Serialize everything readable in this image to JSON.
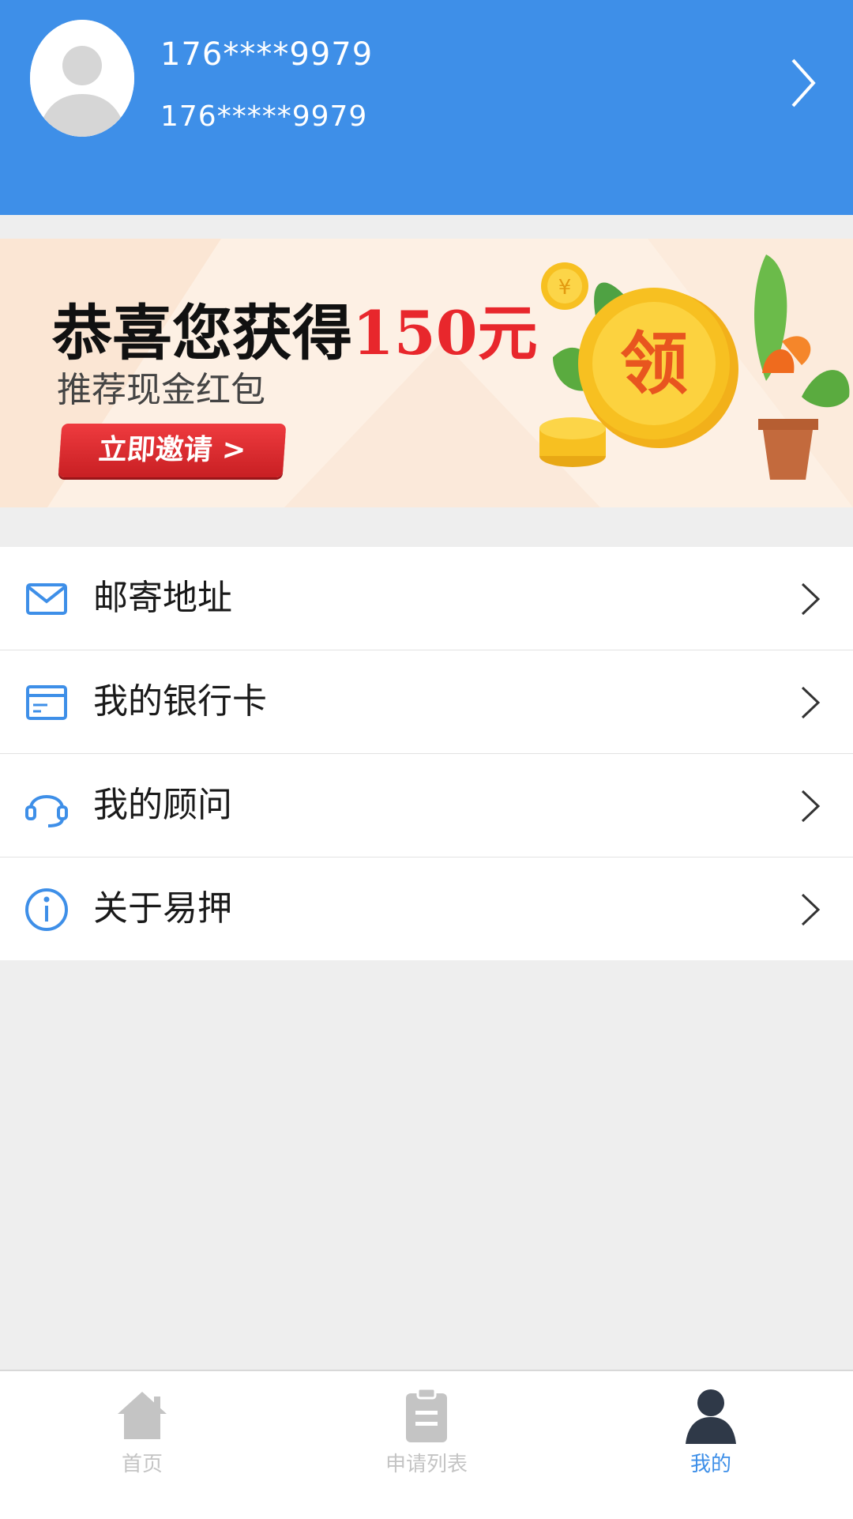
{
  "header": {
    "user_name": "176****9979",
    "user_phone": "176*****9979",
    "icons": {
      "avatar": "default-avatar-icon",
      "chevron": "chevron-right-icon"
    }
  },
  "banner": {
    "title_prefix": "恭喜您获得",
    "title_amount": "150元",
    "subtitle": "推荐现金红包",
    "button_label": "立即邀请 >",
    "coin_label": "领",
    "colors": {
      "amount": "#e8272c",
      "button": "#d9272b",
      "coin": "#f7c021"
    }
  },
  "menu": {
    "items": [
      {
        "label": "邮寄地址",
        "icon": "mail-icon"
      },
      {
        "label": "我的银行卡",
        "icon": "bank-card-icon"
      },
      {
        "label": "我的顾问",
        "icon": "headset-icon"
      },
      {
        "label": "关于易押",
        "icon": "info-icon"
      }
    ]
  },
  "tabbar": {
    "tabs": [
      {
        "label": "首页",
        "icon": "home-icon",
        "active": false
      },
      {
        "label": "申请列表",
        "icon": "clipboard-icon",
        "active": false
      },
      {
        "label": "我的",
        "icon": "user-icon",
        "active": true
      }
    ]
  },
  "colors": {
    "primary": "#3e8fe8",
    "inactive_tab": "#c4c4c4",
    "active_tab_label": "#3e8fe8",
    "active_tab_icon": "#2f3948",
    "page_background": "#eeeeee"
  }
}
